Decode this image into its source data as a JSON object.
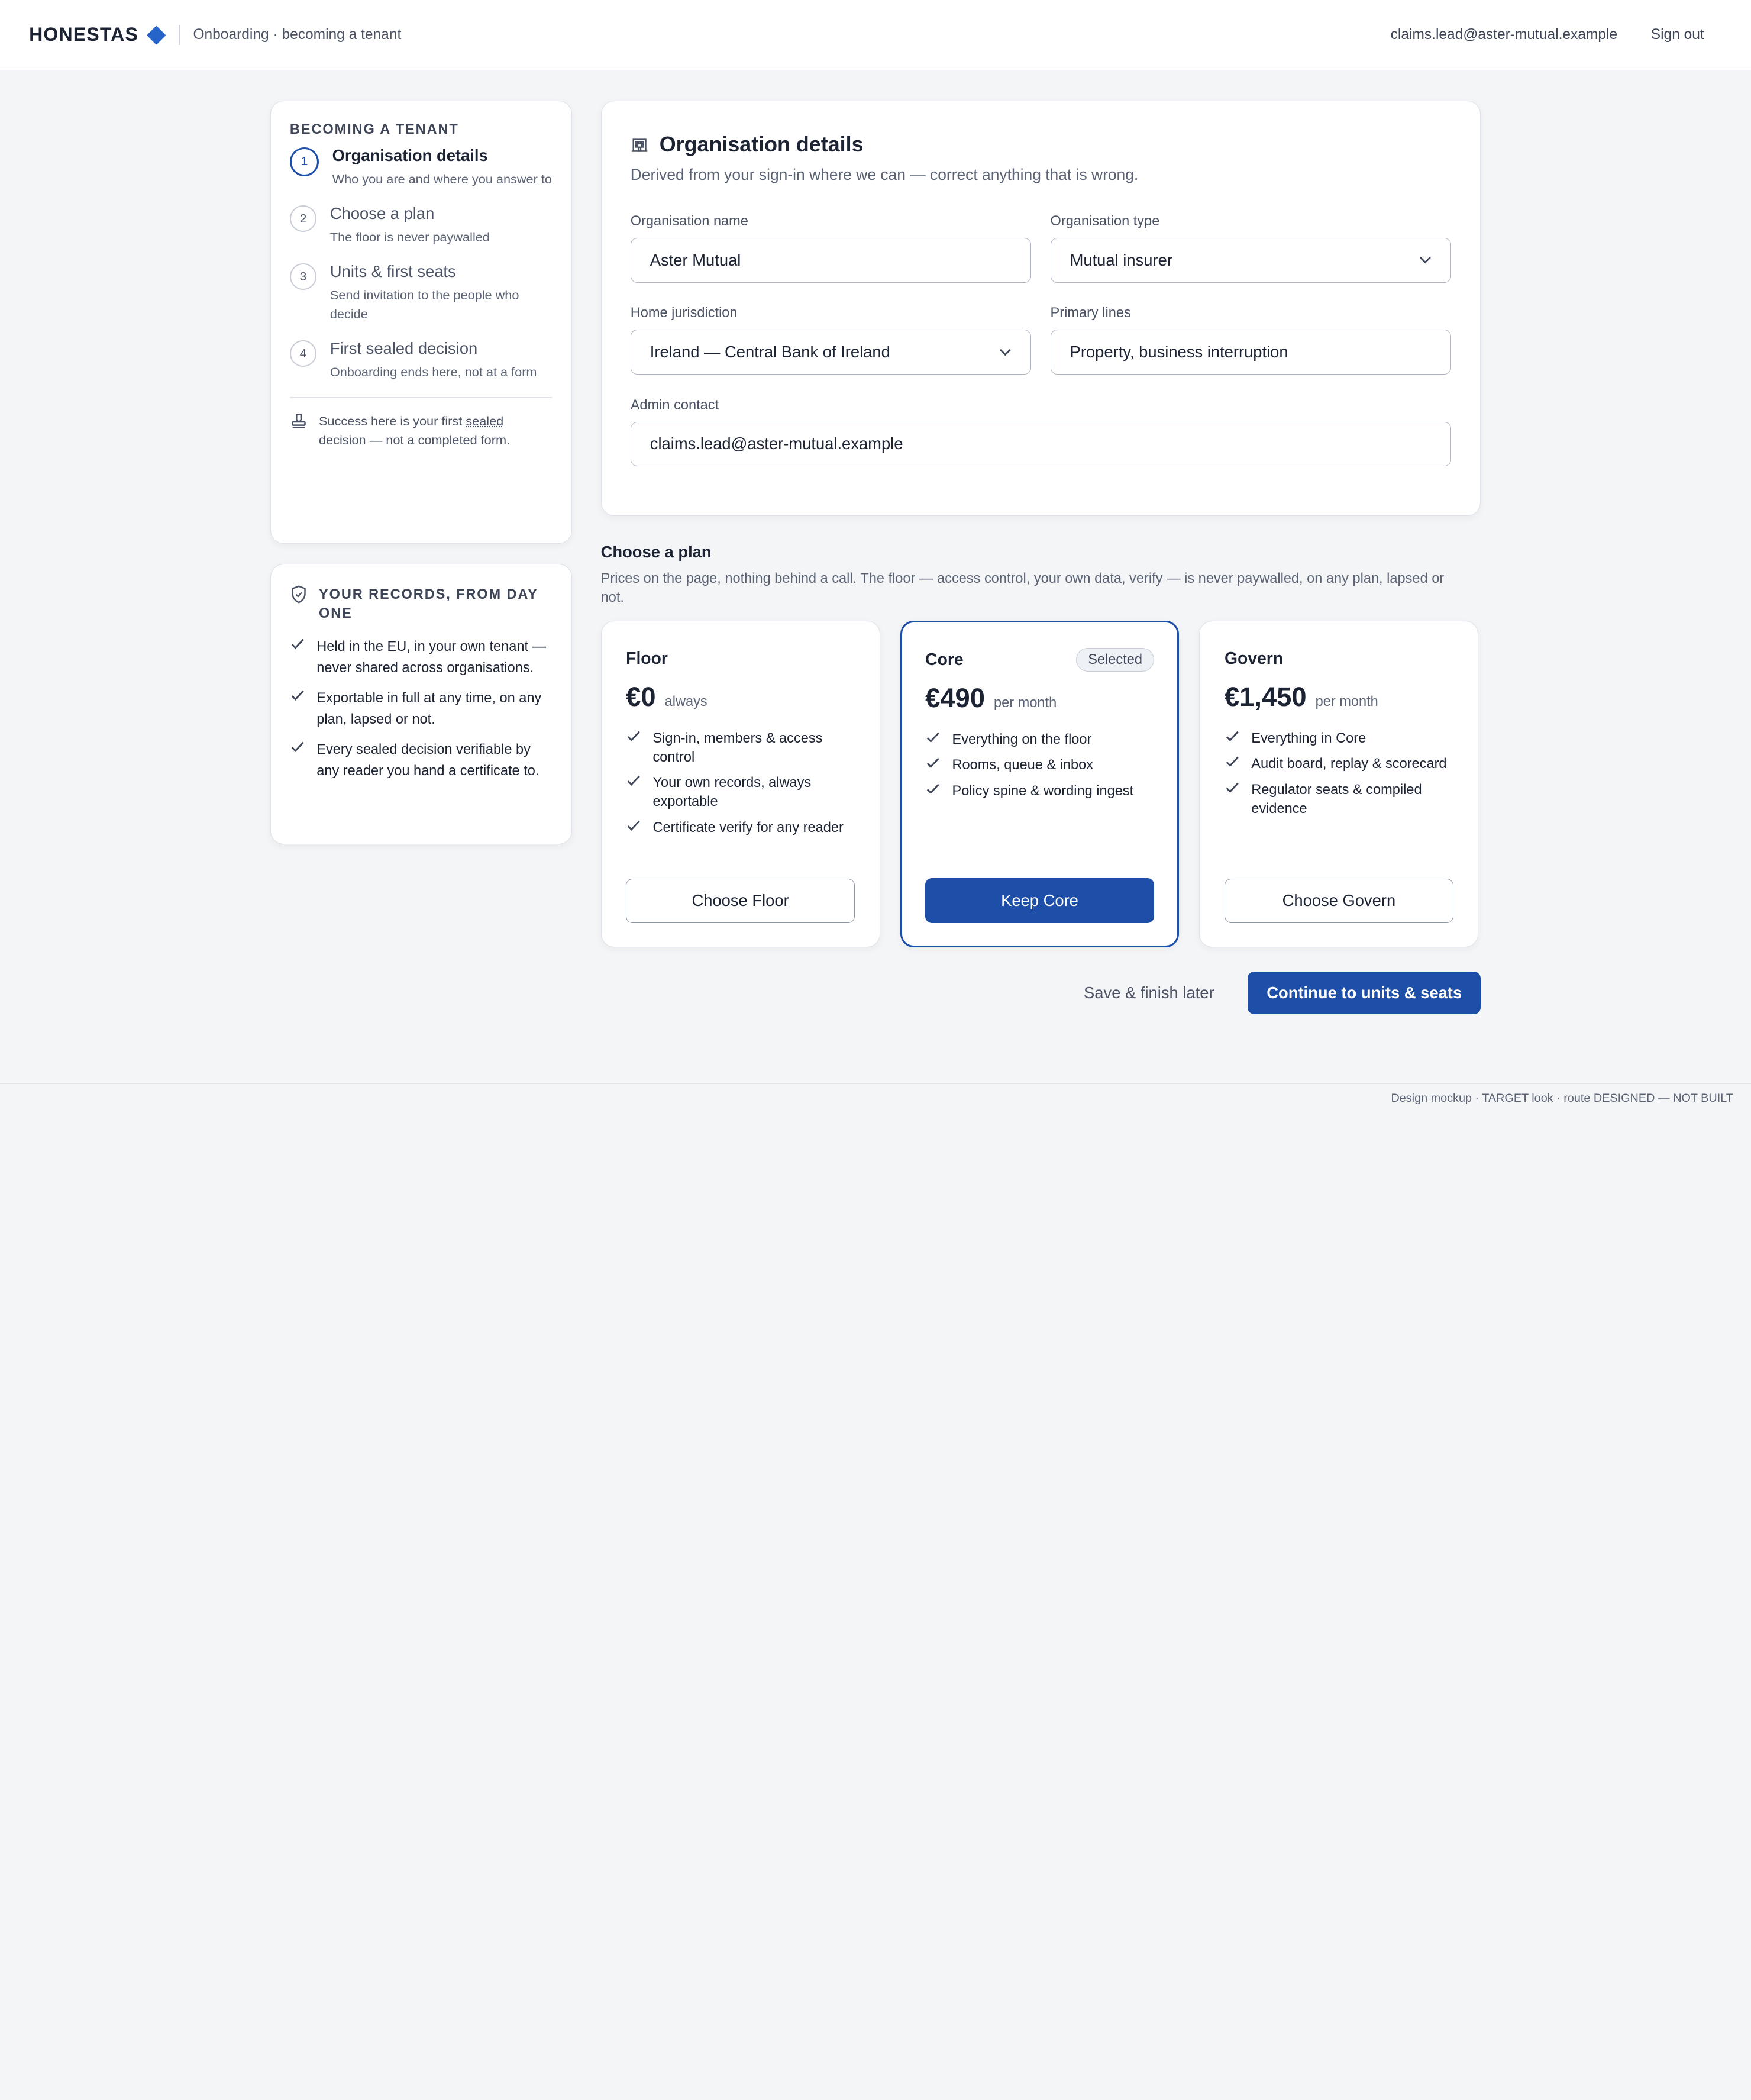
{
  "header": {
    "brand": "HONESTAS",
    "breadcrumb": "Onboarding · becoming a tenant",
    "user_email": "claims.lead@aster-mutual.example",
    "sign_out": "Sign out"
  },
  "steps": {
    "heading": "BECOMING A TENANT",
    "items": [
      {
        "num": "1",
        "title": "Organisation details",
        "sub": "Who you are and where you answer to",
        "active": true
      },
      {
        "num": "2",
        "title": "Choose a plan",
        "sub": "The floor is never paywalled"
      },
      {
        "num": "3",
        "title": "Units & first seats",
        "sub": "Send invitation to the people who decide"
      },
      {
        "num": "4",
        "title": "First sealed decision",
        "sub": "Onboarding ends here, not at a form"
      }
    ],
    "note_before": "Success here is your first ",
    "note_sealed": "sealed",
    "note_after": " decision — not a completed form."
  },
  "records": {
    "heading": "YOUR RECORDS, FROM DAY ONE",
    "items": [
      "Held in the EU, in your own tenant — never shared across organisations.",
      "Exportable in full at any time, on any plan, lapsed or not.",
      "Every sealed decision verifiable by any reader you hand a certificate to."
    ]
  },
  "org": {
    "title": "Organisation details",
    "subtitle": "Derived from your sign-in where we can — correct anything that is wrong.",
    "fields": {
      "name": {
        "label": "Organisation name",
        "value": "Aster Mutual"
      },
      "type": {
        "label": "Organisation type",
        "value": "Mutual insurer"
      },
      "jurisdiction": {
        "label": "Home jurisdiction",
        "value": "Ireland — Central Bank of Ireland"
      },
      "lines": {
        "label": "Primary lines",
        "value": "Property, business interruption"
      },
      "admin": {
        "label": "Admin contact",
        "value": "claims.lead@aster-mutual.example"
      }
    }
  },
  "plans": {
    "title": "Choose a plan",
    "subtitle": "Prices on the page, nothing behind a call. The floor — access control, your own data, verify — is never paywalled, on any plan, lapsed or not.",
    "items": [
      {
        "name": "Floor",
        "price": "€0",
        "period": "always",
        "features": [
          "Sign-in, members & access control",
          "Your own records, always exportable",
          "Certificate verify for any reader"
        ],
        "button": "Choose Floor"
      },
      {
        "name": "Core",
        "badge": "Selected",
        "price": "€490",
        "period": "per month",
        "features": [
          "Everything on the floor",
          "Rooms, queue & inbox",
          "Policy spine & wording ingest"
        ],
        "button": "Keep Core"
      },
      {
        "name": "Govern",
        "price": "€1,450",
        "period": "per month",
        "features": [
          "Everything in Core",
          "Audit board, replay & scorecard",
          "Regulator seats & compiled evidence"
        ],
        "button": "Choose Govern"
      }
    ]
  },
  "actions": {
    "save_later": "Save & finish later",
    "continue": "Continue to units & seats"
  },
  "footer": "Design mockup · TARGET look · route DESIGNED — NOT BUILT",
  "colors": {
    "accent": "#1e4fa8",
    "brand_diamond": "#2764c9",
    "background": "#f4f5f7"
  }
}
